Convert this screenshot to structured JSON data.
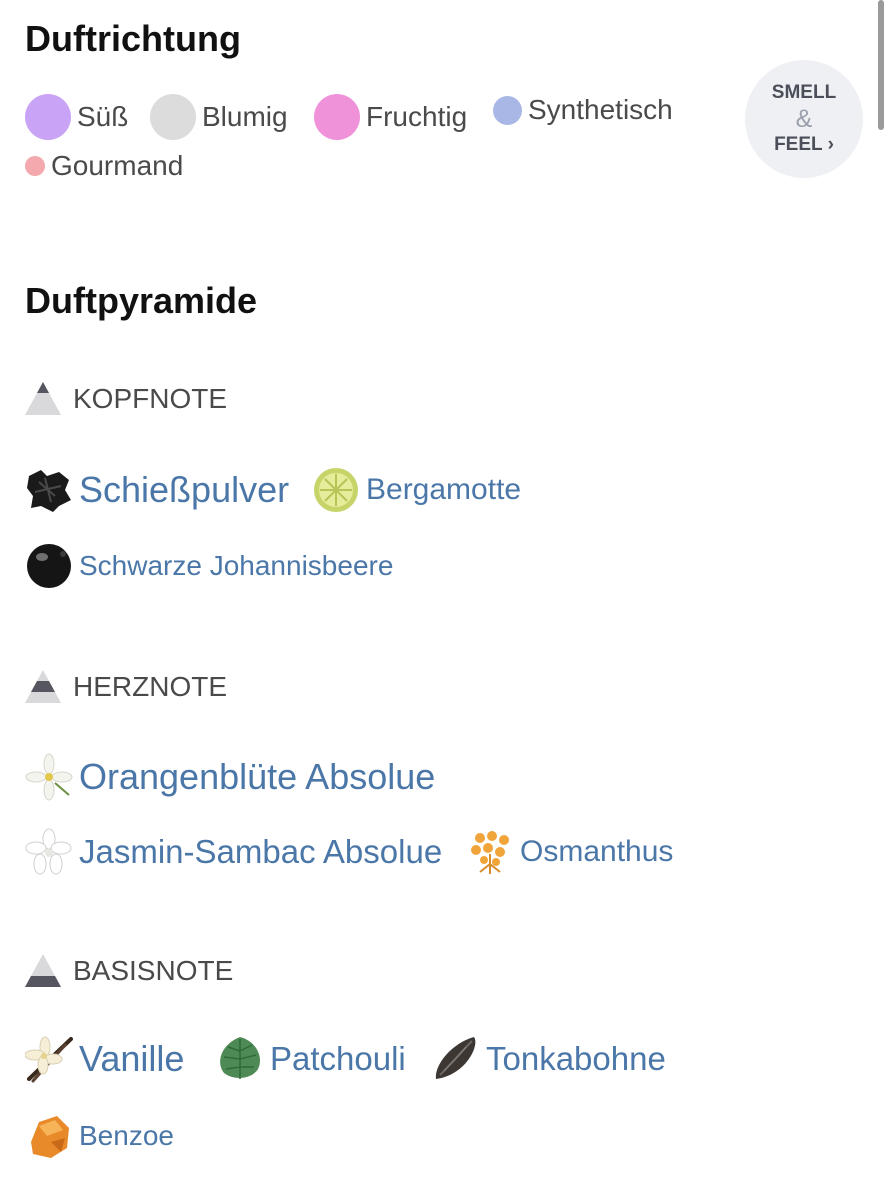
{
  "scent_direction": {
    "title": "Duftrichtung",
    "chips": [
      {
        "label": "Süß",
        "color": "#c9a3f5"
      },
      {
        "label": "Blumig",
        "color": "#dcdcdc"
      },
      {
        "label": "Fruchtig",
        "color": "#ef92d9"
      },
      {
        "label": "Synthetisch",
        "color": "#a8b7e6"
      },
      {
        "label": "Gourmand",
        "color": "#f3a9ad"
      }
    ],
    "smell_button": {
      "line1": "SMELL",
      "line2": "&",
      "line3": "FEEL",
      "chevron": "›"
    }
  },
  "pyramid": {
    "title": "Duftpyramide",
    "top": {
      "label": "KOPFNOTE",
      "notes": [
        {
          "label": "Schießpulver",
          "icon": "gunpowder-icon"
        },
        {
          "label": "Bergamotte",
          "icon": "bergamot-icon"
        },
        {
          "label": "Schwarze Johannisbeere",
          "icon": "blackcurrant-icon"
        }
      ]
    },
    "heart": {
      "label": "HERZNOTE",
      "notes": [
        {
          "label": "Orangenblüte Absolue",
          "icon": "orange-blossom-icon"
        },
        {
          "label": "Jasmin-Sambac Absolue",
          "icon": "jasmine-icon"
        },
        {
          "label": "Osmanthus",
          "icon": "osmanthus-icon"
        }
      ]
    },
    "base": {
      "label": "BASISNOTE",
      "notes": [
        {
          "label": "Vanille",
          "icon": "vanilla-icon"
        },
        {
          "label": "Patchouli",
          "icon": "patchouli-icon"
        },
        {
          "label": "Tonkabohne",
          "icon": "tonka-bean-icon"
        },
        {
          "label": "Benzoe",
          "icon": "benzoin-icon"
        }
      ]
    }
  }
}
